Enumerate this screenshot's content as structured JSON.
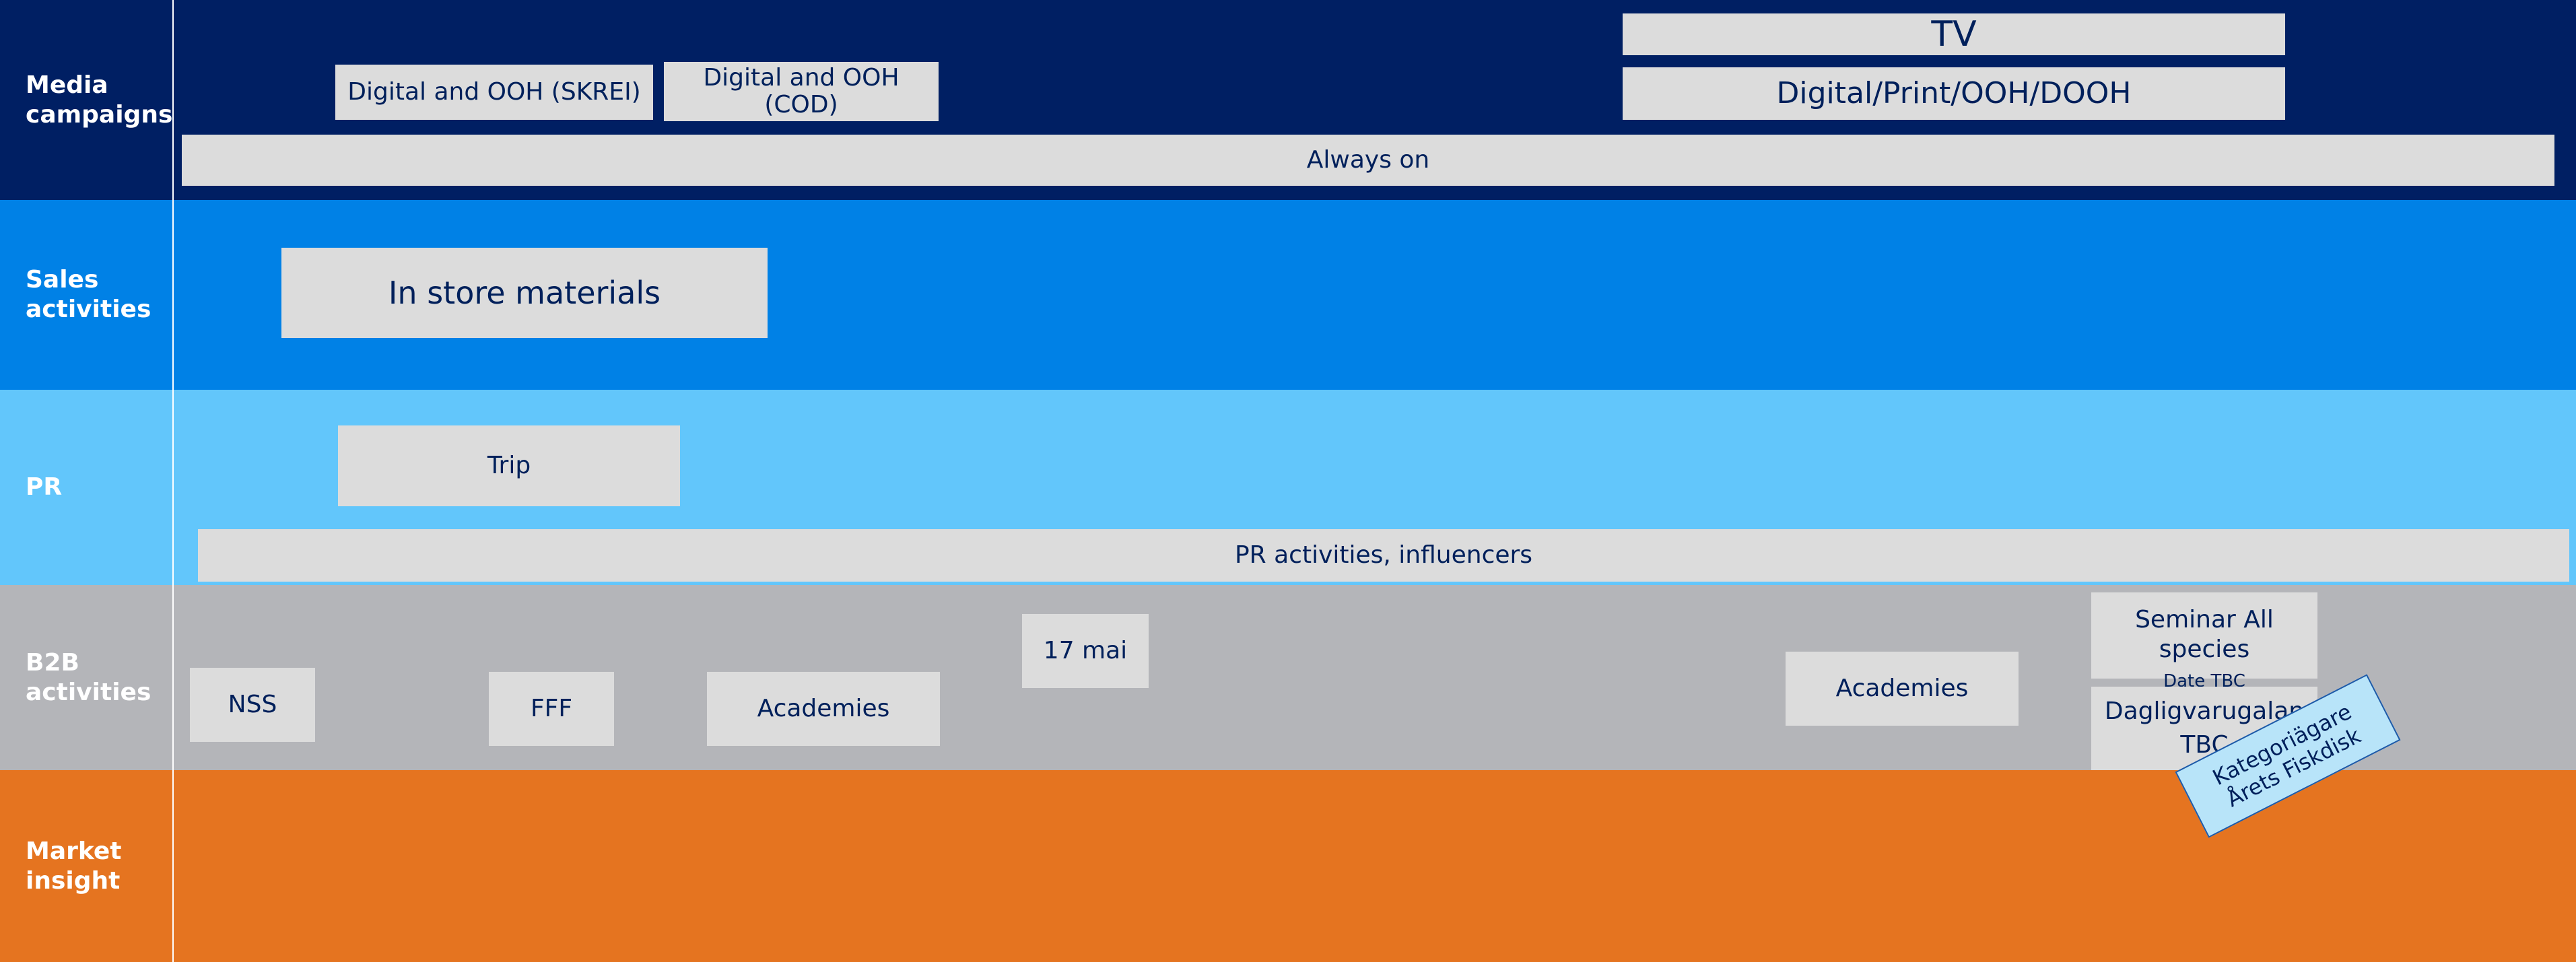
{
  "lanes": {
    "media": {
      "label": "Media\ncampaigns",
      "color": "#001f63"
    },
    "sales": {
      "label": "Sales\nactivities",
      "color": "#0081e6"
    },
    "pr": {
      "label": "PR",
      "color": "#62c6fb"
    },
    "b2b": {
      "label": "B2B\nactivities",
      "color": "#b4b5b9"
    },
    "market": {
      "label": "Market\ninsight",
      "color": "#e57420"
    }
  },
  "media": {
    "skrei": "Digital and OOH (SKREI)",
    "cod": "Digital and OOH\n(COD)",
    "tv": "TV",
    "digital_print": "Digital/Print/OOH/DOOH",
    "always_on": "Always on"
  },
  "sales": {
    "in_store": "In store materials"
  },
  "pr": {
    "trip": "Trip",
    "activities": "PR activities, influencers"
  },
  "b2b": {
    "nss": "NSS",
    "fff": "FFF",
    "academies_1": "Academies",
    "mai": "17 mai",
    "academies_2": "Academies",
    "seminar": "Seminar All\nspecies",
    "seminar_date": "Date TBC",
    "dagligvaru": "Dagligvarugalan\nTBC",
    "kategori": "Kategoriägare\nÅrets Fiskdisk"
  },
  "colors": {
    "box": "#dcdcdc",
    "box_text": "#00205b",
    "callout": "#b8e4f9"
  }
}
